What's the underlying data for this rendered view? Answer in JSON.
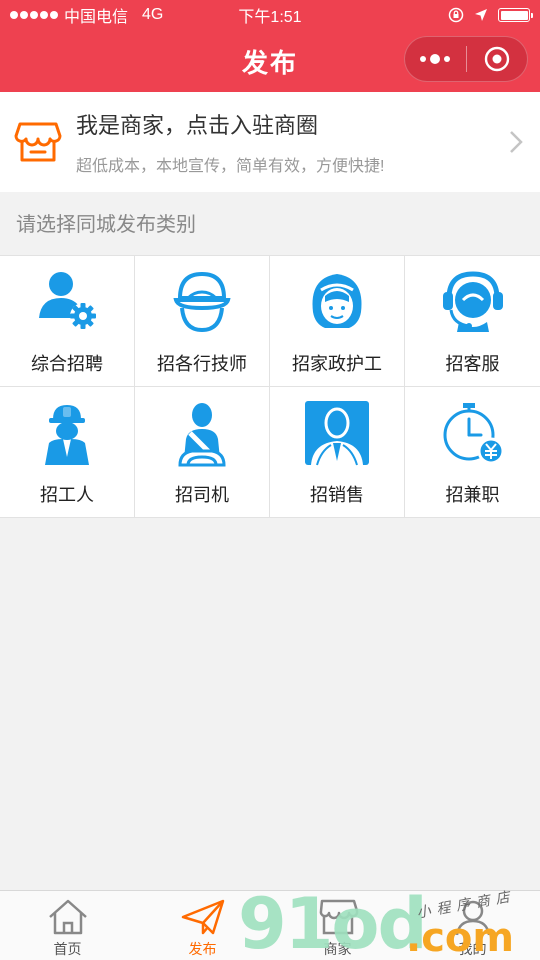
{
  "status_bar": {
    "carrier": "中国电信",
    "network": "4G",
    "time": "下午1:51"
  },
  "nav": {
    "title": "发布"
  },
  "merchant_banner": {
    "title": "我是商家，点击入驻商圈",
    "subtitle": "超低成本，本地宣传，简单有效，方便快捷!"
  },
  "section_label": "请选择同城发布类别",
  "categories": [
    {
      "label": "综合招聘",
      "icon": "recruit-gear-icon"
    },
    {
      "label": "招各行技师",
      "icon": "technician-cap-icon"
    },
    {
      "label": "招家政护工",
      "icon": "housekeeper-icon"
    },
    {
      "label": "招客服",
      "icon": "headset-agent-icon"
    },
    {
      "label": "招工人",
      "icon": "worker-helmet-icon"
    },
    {
      "label": "招司机",
      "icon": "driver-seatbelt-icon"
    },
    {
      "label": "招销售",
      "icon": "salesman-portrait-icon"
    },
    {
      "label": "招兼职",
      "icon": "part-time-clock-icon"
    }
  ],
  "tabs": [
    {
      "label": "首页",
      "icon": "home-icon",
      "active": false
    },
    {
      "label": "发布",
      "icon": "paper-plane-icon",
      "active": true
    },
    {
      "label": "商家",
      "icon": "shop-icon",
      "active": false
    },
    {
      "label": "我的",
      "icon": "user-icon",
      "active": false
    }
  ],
  "watermark": {
    "main": "91od",
    "domain": ".com",
    "tagline": "小程序商店"
  },
  "colors": {
    "header_red": "#ee4150",
    "icon_blue": "#1a9ae6",
    "accent_orange": "#ff6a00"
  }
}
